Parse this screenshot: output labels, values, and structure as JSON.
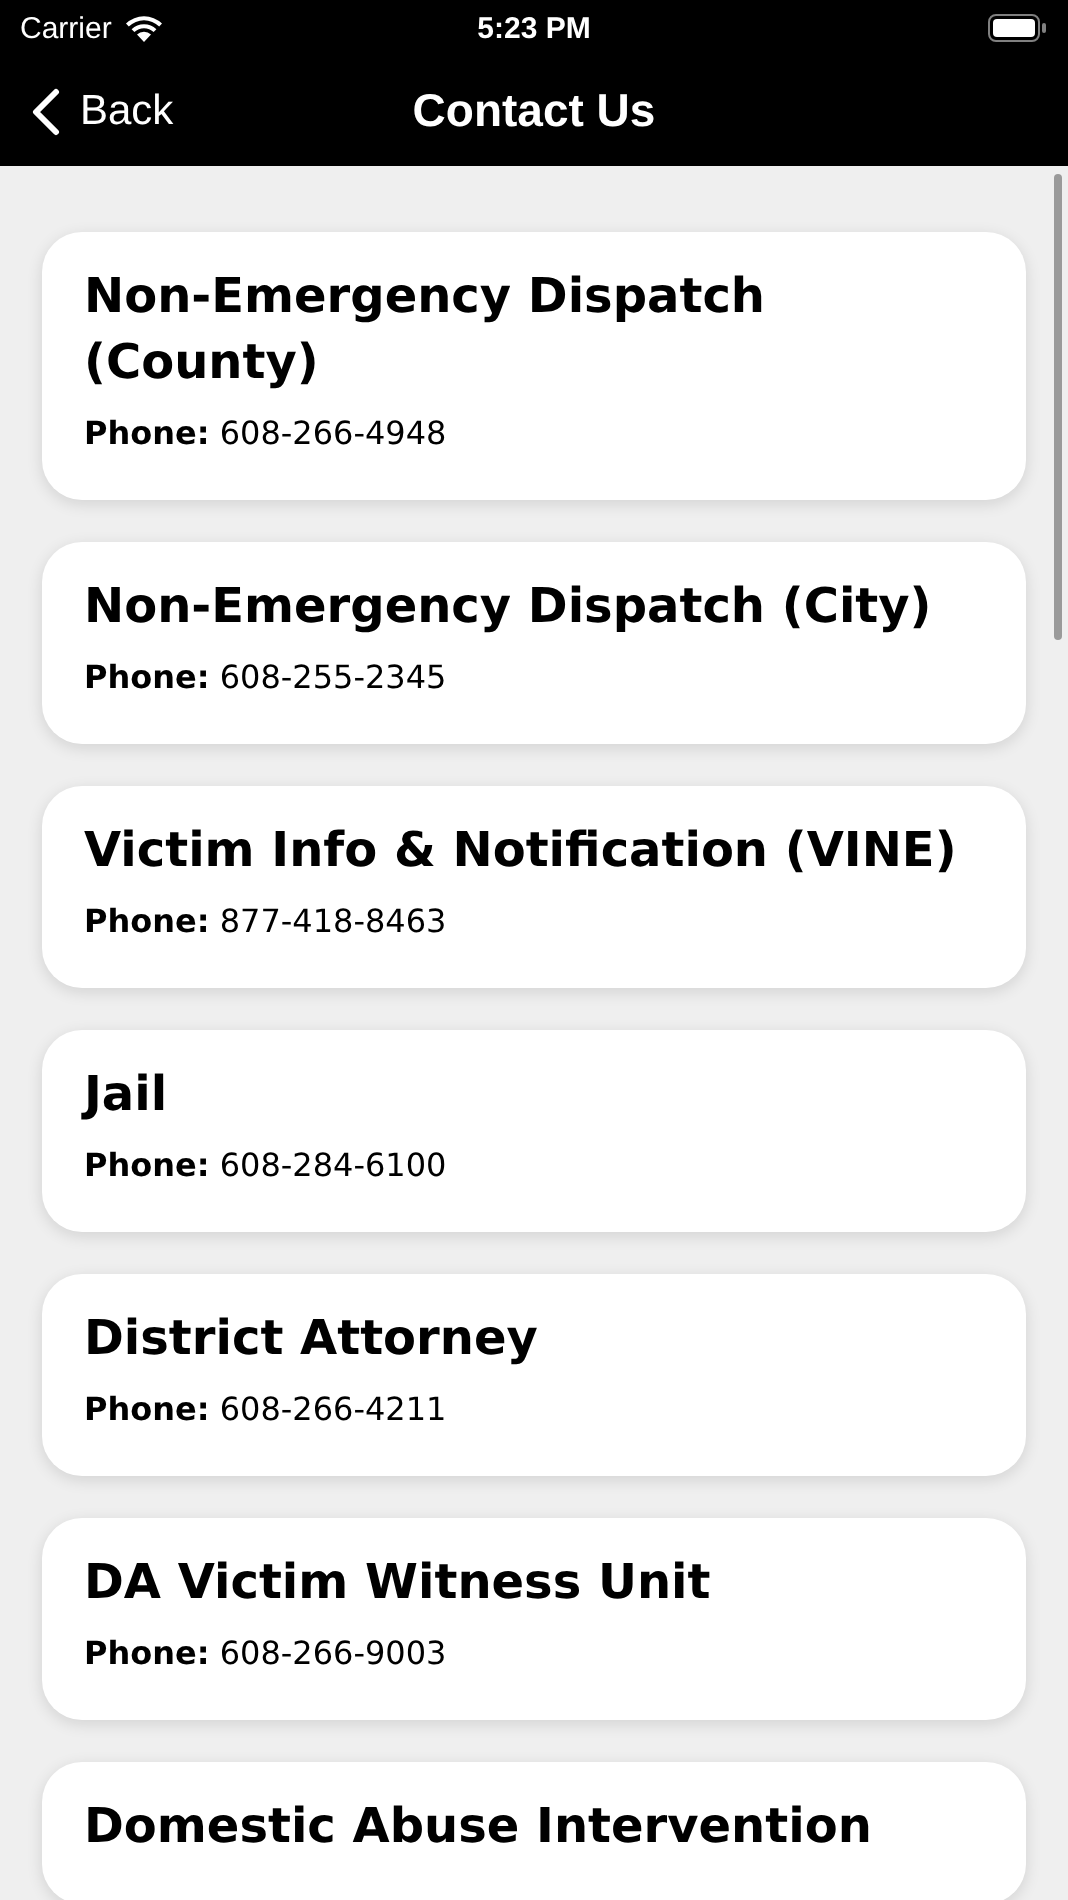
{
  "status_bar": {
    "carrier": "Carrier",
    "time": "5:23 PM"
  },
  "nav": {
    "back": "Back",
    "title": "Contact Us"
  },
  "contacts": [
    {
      "name": "Non-Emergency Dispatch (County)",
      "phone_label": "Phone:",
      "phone": "608-266-4948"
    },
    {
      "name": "Non-Emergency Dispatch (City)",
      "phone_label": "Phone:",
      "phone": "608-255-2345"
    },
    {
      "name": "Victim Info & Notification (VINE)",
      "phone_label": "Phone:",
      "phone": "877-418-8463"
    },
    {
      "name": "Jail",
      "phone_label": "Phone:",
      "phone": "608-284-6100"
    },
    {
      "name": "District Attorney",
      "phone_label": "Phone:",
      "phone": "608-266-4211"
    },
    {
      "name": "DA Victim Witness Unit",
      "phone_label": "Phone:",
      "phone": "608-266-9003"
    },
    {
      "name": "Domestic Abuse Intervention"
    }
  ]
}
